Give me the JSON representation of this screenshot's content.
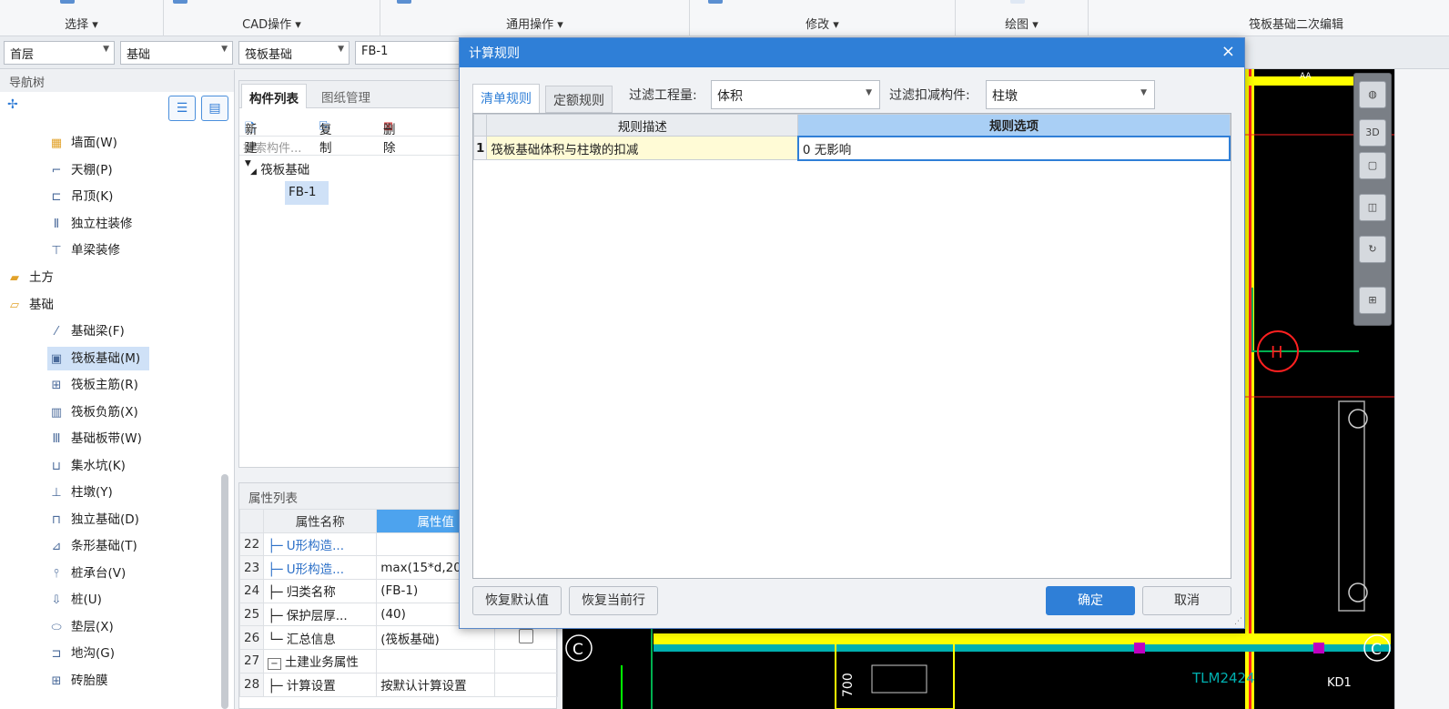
{
  "ribbon": {
    "groups": [
      {
        "label": "选择 ▾"
      },
      {
        "label": "CAD操作 ▾"
      },
      {
        "label": "通用操作 ▾"
      },
      {
        "label": "修改 ▾"
      },
      {
        "label": "绘图 ▾"
      }
    ],
    "right_title": "筏板基础二次编辑"
  },
  "selectors": {
    "floor": "首层",
    "category": "基础",
    "type": "筏板基础",
    "component": "FB-1"
  },
  "nav": {
    "title": "导航树",
    "items": [
      {
        "label": "墙面(W)",
        "icon": "wall-surface-icon"
      },
      {
        "label": "天棚(P)",
        "icon": "ceiling-icon"
      },
      {
        "label": "吊顶(K)",
        "icon": "suspended-ceiling-icon"
      },
      {
        "label": "独立柱装修",
        "icon": "column-finish-icon"
      },
      {
        "label": "单梁装修",
        "icon": "beam-finish-icon"
      },
      {
        "label": "土方",
        "icon": "folder-icon"
      },
      {
        "label": "基础",
        "icon": "folder-open-icon"
      },
      {
        "label": "基础梁(F)",
        "icon": "foundation-beam-icon"
      },
      {
        "label": "筏板基础(M)",
        "icon": "raft-foundation-icon"
      },
      {
        "label": "筏板主筋(R)",
        "icon": "raft-main-rebar-icon"
      },
      {
        "label": "筏板负筋(X)",
        "icon": "raft-negative-rebar-icon"
      },
      {
        "label": "基础板带(W)",
        "icon": "foundation-strip-icon"
      },
      {
        "label": "集水坑(K)",
        "icon": "sump-pit-icon"
      },
      {
        "label": "柱墩(Y)",
        "icon": "column-pier-icon"
      },
      {
        "label": "独立基础(D)",
        "icon": "isolated-foundation-icon"
      },
      {
        "label": "条形基础(T)",
        "icon": "strip-foundation-icon"
      },
      {
        "label": "桩承台(V)",
        "icon": "pile-cap-icon"
      },
      {
        "label": "桩(U)",
        "icon": "pile-icon"
      },
      {
        "label": "垫层(X)",
        "icon": "cushion-icon"
      },
      {
        "label": "地沟(G)",
        "icon": "trench-icon"
      },
      {
        "label": "砖胎膜",
        "icon": "brick-form-icon"
      }
    ]
  },
  "component_panel": {
    "tabs": [
      "构件列表",
      "图纸管理"
    ],
    "new_label": "新建 ▾",
    "copy_label": "复制",
    "delete_label": "删除",
    "search_placeholder": "搜索构件...",
    "tree_parent": "筏板基础",
    "tree_child": "FB-1"
  },
  "properties": {
    "title": "属性列表",
    "col_name": "属性名称",
    "col_value": "属性值",
    "rows": [
      {
        "num": "22",
        "name": "U形构造...",
        "value": ""
      },
      {
        "num": "23",
        "name": "U形构造...",
        "value": "max(15*d,20"
      },
      {
        "num": "24",
        "name": "归类名称",
        "value": "(FB-1)"
      },
      {
        "num": "25",
        "name": "保护层厚...",
        "value": "(40)"
      },
      {
        "num": "26",
        "name": "汇总信息",
        "value": "(筏板基础)"
      },
      {
        "num": "27",
        "name": "土建业务属性",
        "value": ""
      },
      {
        "num": "28",
        "name": "计算设置",
        "value": "按默认计算设置"
      }
    ]
  },
  "cad": {
    "labels": [
      "H",
      "C",
      "C",
      "TLM2424",
      "KD1",
      "700",
      "AA"
    ],
    "colors": {
      "background": "#000000",
      "wall": "#ffff00",
      "line": "#00b050",
      "red": "#ff2020"
    }
  },
  "dialog": {
    "title": "计算规则",
    "tabs": [
      "清单规则",
      "定额规则"
    ],
    "filter_quantity_label": "过滤工程量:",
    "filter_quantity_value": "体积",
    "filter_component_label": "过滤扣减构件:",
    "filter_component_value": "柱墩",
    "col_desc": "规则描述",
    "col_option": "规则选项",
    "rows": [
      {
        "num": "1",
        "desc": "筏板基础体积与柱墩的扣减",
        "option": "0  无影响"
      }
    ],
    "btn_restore_default": "恢复默认值",
    "btn_restore_row": "恢复当前行",
    "btn_ok": "确定",
    "btn_cancel": "取消"
  },
  "colors": {
    "accent": "#2f7fd7",
    "header_highlight": "#a9cff5",
    "selection": "#cfe1f7"
  }
}
